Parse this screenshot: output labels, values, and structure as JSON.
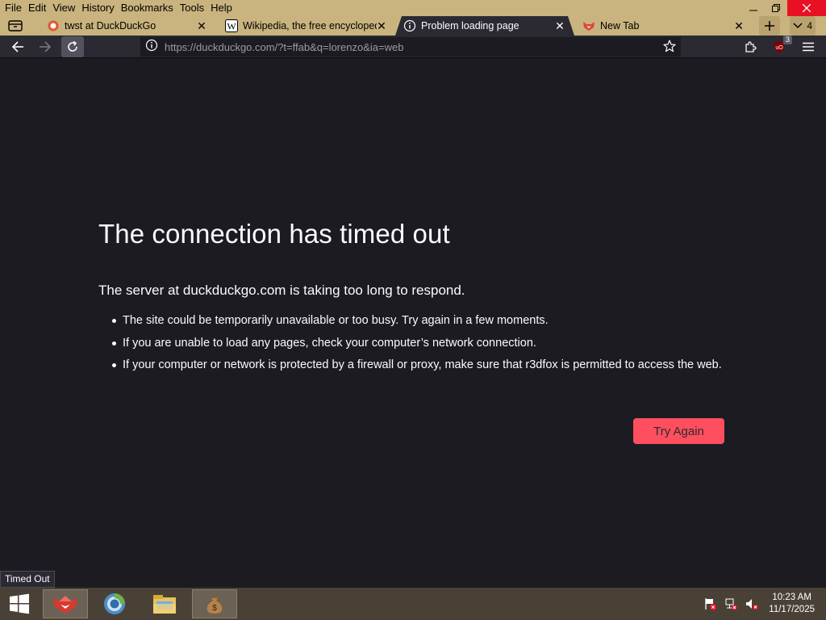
{
  "menubar": {
    "items": [
      {
        "label": "File"
      },
      {
        "label": "Edit"
      },
      {
        "label": "View"
      },
      {
        "label": "History"
      },
      {
        "label": "Bookmarks"
      },
      {
        "label": "Tools"
      },
      {
        "label": "Help"
      }
    ]
  },
  "tabs": [
    {
      "title": "twst at DuckDuckGo",
      "icon": "duckduckgo-icon",
      "active": false
    },
    {
      "title": "Wikipedia, the free encyclopedi",
      "icon": "wikipedia-icon",
      "active": false
    },
    {
      "title": "Problem loading page",
      "icon": "info-icon",
      "active": true
    },
    {
      "title": "New Tab",
      "icon": "r3dfox-icon",
      "active": false
    }
  ],
  "tab_count": "4",
  "urlbar": {
    "host": "https://duckduckgo.com",
    "path": "/?t=ffab&q=lorenzo&ia=web"
  },
  "extension_badge": "3",
  "error_page": {
    "title": "The connection has timed out",
    "subtitle": "The server at duckduckgo.com is taking too long to respond.",
    "suggestions": [
      "The site could be temporarily unavailable or too busy. Try again in a few moments.",
      "If you are unable to load any pages, check your computer’s network connection.",
      "If your computer or network is protected by a firewall or proxy, make sure that r3dfox is permitted to access the web."
    ],
    "button_label": "Try Again"
  },
  "status_text": "Timed Out",
  "taskbar": {
    "apps": [
      "r3dfox-icon",
      "chromium-icon",
      "file-explorer-icon",
      "money-bag-icon"
    ],
    "time": "10:23 AM",
    "date": "11/17/2025"
  },
  "colors": {
    "menubar_bg": "#c9b37e",
    "content_bg": "#1c1b22",
    "accent_button": "#ff4f5e",
    "close_button": "#e81123"
  }
}
